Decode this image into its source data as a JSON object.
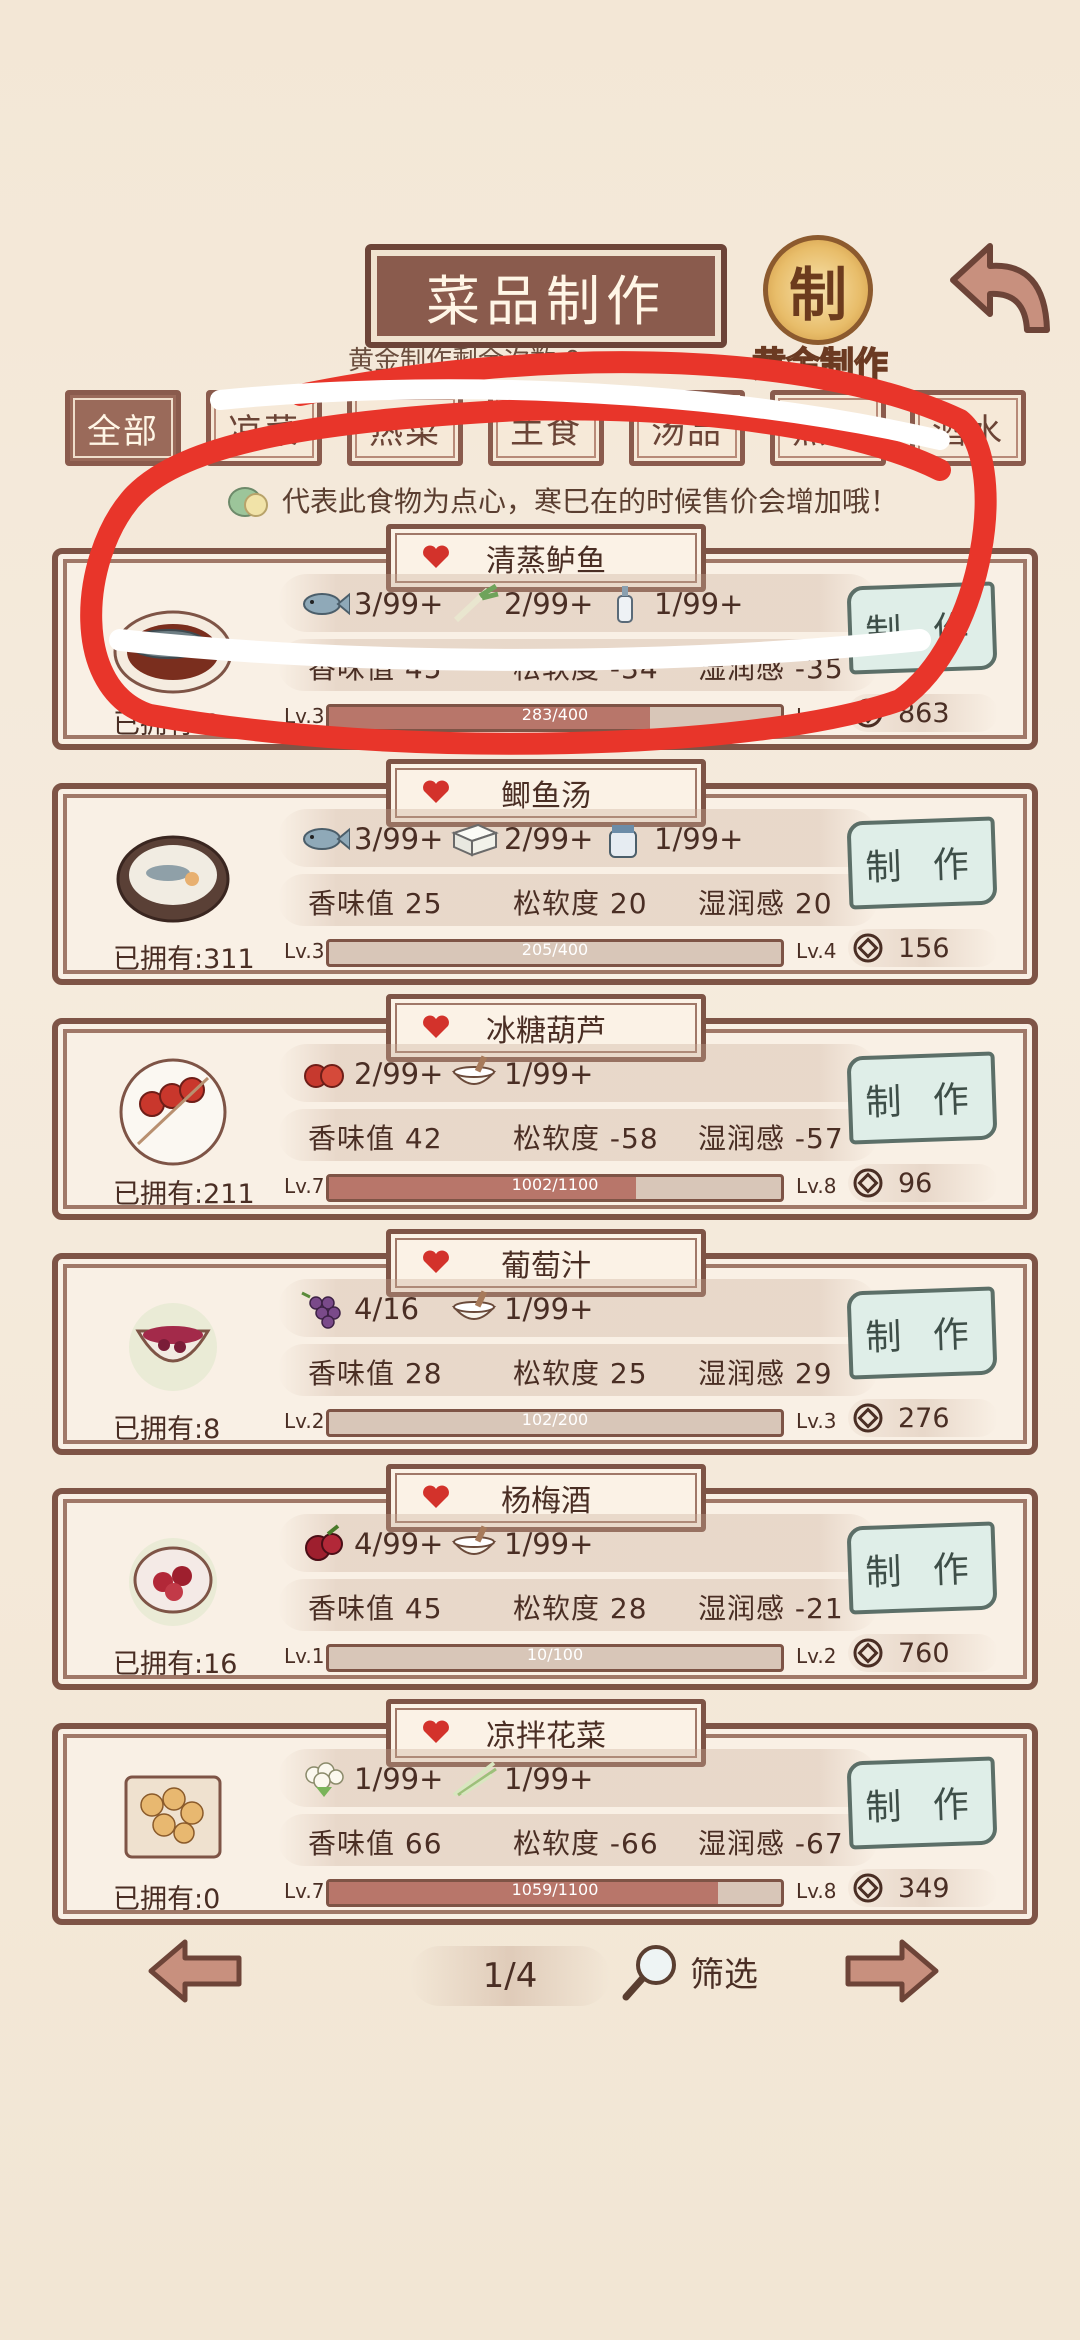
{
  "header": {
    "title": "菜品制作",
    "gold_note": "黄金制作剩余次数 0",
    "gold_seal_char": "制",
    "gold_button_label": "黄金制作"
  },
  "tabs": [
    {
      "label": "全部",
      "active": true
    },
    {
      "label": "凉菜",
      "active": false
    },
    {
      "label": "热菜",
      "active": false
    },
    {
      "label": "主食",
      "active": false
    },
    {
      "label": "汤品",
      "active": false
    },
    {
      "label": "点心",
      "active": false
    },
    {
      "label": "酒水",
      "active": false
    }
  ],
  "hint": "代表此食物为点心，寒巳在的时候售价会增加哦！",
  "recipes": [
    {
      "name": "清蒸鲈鱼",
      "ingredients": [
        {
          "icon": "fish-icon",
          "amount": "3/99+"
        },
        {
          "icon": "scallion-icon",
          "amount": "2/99+"
        },
        {
          "icon": "wine-bottle-icon",
          "amount": "1/99+"
        }
      ],
      "stats": {
        "aroma": "香味值 45",
        "softness": "松软度 -34",
        "moisture": "湿润感 -35"
      },
      "owned": "已拥有:0",
      "level": "Lv.3",
      "next_level": "Lv.4",
      "progress_text": "283/400",
      "progress": 0.71,
      "price": "863",
      "make_label": "制 作"
    },
    {
      "name": "鲫鱼汤",
      "ingredients": [
        {
          "icon": "fish-icon",
          "amount": "3/99+"
        },
        {
          "icon": "tofu-icon",
          "amount": "2/99+"
        },
        {
          "icon": "milk-jar-icon",
          "amount": "1/99+"
        }
      ],
      "stats": {
        "aroma": "香味值 25",
        "softness": "松软度 20",
        "moisture": "湿润感 20"
      },
      "owned": "已拥有:311",
      "level": "Lv.3",
      "next_level": "Lv.4",
      "progress_text": "205/400",
      "progress": 0.0,
      "price": "156",
      "make_label": "制 作"
    },
    {
      "name": "冰糖葫芦",
      "ingredients": [
        {
          "icon": "hawthorn-icon",
          "amount": "2/99+"
        },
        {
          "icon": "sugar-bowl-icon",
          "amount": "1/99+"
        }
      ],
      "stats": {
        "aroma": "香味值 42",
        "softness": "松软度 -58",
        "moisture": "湿润感 -57"
      },
      "owned": "已拥有:211",
      "level": "Lv.7",
      "next_level": "Lv.8",
      "progress_text": "1002/1100",
      "progress": 0.68,
      "price": "96",
      "make_label": "制 作"
    },
    {
      "name": "葡萄汁",
      "ingredients": [
        {
          "icon": "grape-icon",
          "amount": "4/16"
        },
        {
          "icon": "sugar-bowl-icon",
          "amount": "1/99+"
        }
      ],
      "stats": {
        "aroma": "香味值 28",
        "softness": "松软度 25",
        "moisture": "湿润感 29"
      },
      "owned": "已拥有:8",
      "level": "Lv.2",
      "next_level": "Lv.3",
      "progress_text": "102/200",
      "progress": 0.0,
      "price": "276",
      "make_label": "制 作"
    },
    {
      "name": "杨梅酒",
      "ingredients": [
        {
          "icon": "bayberry-icon",
          "amount": "4/99+"
        },
        {
          "icon": "sugar-bowl-icon",
          "amount": "1/99+"
        }
      ],
      "stats": {
        "aroma": "香味值 45",
        "softness": "松软度 28",
        "moisture": "湿润感 -21"
      },
      "owned": "已拥有:16",
      "level": "Lv.1",
      "next_level": "Lv.2",
      "progress_text": "10/100",
      "progress": 0.0,
      "price": "760",
      "make_label": "制 作"
    },
    {
      "name": "凉拌花菜",
      "ingredients": [
        {
          "icon": "cauliflower-icon",
          "amount": "1/99+"
        },
        {
          "icon": "green-onion-icon",
          "amount": "1/99+"
        }
      ],
      "stats": {
        "aroma": "香味值 66",
        "softness": "松软度 -66",
        "moisture": "湿润感 -67"
      },
      "owned": "已拥有:0",
      "level": "Lv.7",
      "next_level": "Lv.8",
      "progress_text": "1059/1100",
      "progress": 0.86,
      "price": "349",
      "make_label": "制 作"
    }
  ],
  "pagination": {
    "page": "1/4",
    "filter_label": "筛选"
  },
  "colors": {
    "brown": "#7e5446",
    "scribble_red": "#e8352a",
    "scribble_white": "#ffffff"
  }
}
